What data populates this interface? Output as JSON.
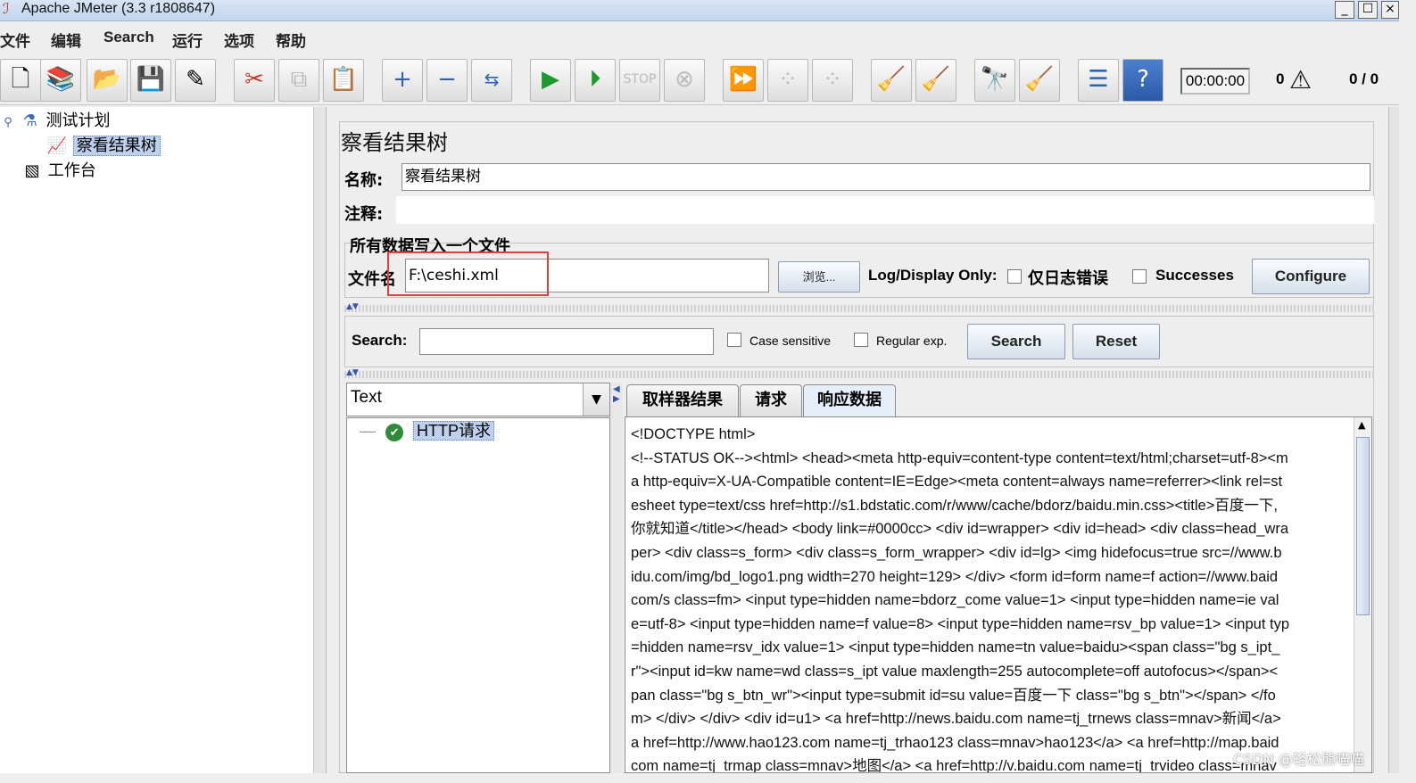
{
  "window": {
    "title": "Apache JMeter (3.3 r1808647)",
    "controls": [
      "_",
      "☐",
      "×"
    ]
  },
  "menu": [
    "文件",
    "编辑",
    "Search",
    "运行",
    "选项",
    "帮助"
  ],
  "toolbar": {
    "icons": [
      "new-icon",
      "templates-icon",
      "open-icon",
      "save-icon",
      "save-as-icon",
      "cut-icon",
      "copy-icon",
      "paste-icon",
      "expand-icon",
      "collapse-icon",
      "toggle-icon",
      "start-icon",
      "start-no-pause-icon",
      "stop-icon",
      "shutdown-icon",
      "remote-start-icon",
      "remote-stop-icon",
      "remote-shutdown-icon",
      "clear-icon",
      "clear-all-icon",
      "search-icon",
      "reset-search-icon",
      "function-helper-icon",
      "help-icon"
    ],
    "timer": "00:00:00",
    "error_count": "0",
    "thread_count": "0 / 0"
  },
  "tree": {
    "plan": "测试计划",
    "listener": "察看结果树",
    "workbench": "工作台"
  },
  "panel": {
    "title": "察看结果树",
    "name_label": "名称:",
    "name_value": "察看结果树",
    "comment_label": "注释:",
    "comment_value": "",
    "group_title": "所有数据写入一个文件",
    "filename_label": "文件名",
    "filename_value": "F:\\ceshi.xml",
    "browse_label": "浏览...",
    "log_only_label": "Log/Display Only:",
    "errors_label": "仅日志错误",
    "successes_label": "Successes",
    "configure_label": "Configure"
  },
  "search": {
    "label": "Search:",
    "value": "",
    "case_label": "Case sensitive",
    "regex_label": "Regular exp.",
    "search_btn": "Search",
    "reset_btn": "Reset"
  },
  "results": {
    "renderer": "Text",
    "sampler": "HTTP请求",
    "tabs": [
      "取样器结果",
      "请求",
      "响应数据"
    ],
    "active_tab": "响应数据",
    "response_lines": [
      "<!DOCTYPE html>",
      "<!--STATUS OK--><html> <head><meta http-equiv=content-type content=text/html;charset=utf-8><m",
      "a http-equiv=X-UA-Compatible content=IE=Edge><meta content=always name=referrer><link rel=st",
      "esheet type=text/css href=http://s1.bdstatic.com/r/www/cache/bdorz/baidu.min.css><title>百度一下,",
      "你就知道</title></head> <body link=#0000cc> <div id=wrapper> <div id=head> <div class=head_wra",
      "per> <div class=s_form> <div class=s_form_wrapper> <div id=lg> <img hidefocus=true src=//www.b",
      "idu.com/img/bd_logo1.png width=270 height=129> </div> <form id=form name=f action=//www.baid",
      "com/s class=fm> <input type=hidden name=bdorz_come value=1> <input type=hidden name=ie val",
      "e=utf-8> <input type=hidden name=f value=8> <input type=hidden name=rsv_bp value=1> <input typ",
      "=hidden name=rsv_idx value=1> <input type=hidden name=tn value=baidu><span class=\"bg s_ipt_",
      "r\"><input id=kw name=wd class=s_ipt value maxlength=255 autocomplete=off autofocus></span><",
      "pan class=\"bg s_btn_wr\"><input type=submit id=su value=百度一下 class=\"bg s_btn\"></span> </fo",
      "m> </div> </div> <div id=u1> <a href=http://news.baidu.com name=tj_trnews class=mnav>新闻</a>",
      "a href=http://www.hao123.com name=tj_trhao123 class=mnav>hao123</a> <a href=http://map.baid",
      "com name=tj_trmap class=mnav>地图</a> <a href=http://v.baidu.com name=tj_trvideo class=mnav"
    ]
  },
  "watermark": "CSDN @轻松熊喵喵",
  "colors": {
    "selection": "#bdd1ee",
    "highlight_box": "#e0413a",
    "ok_green": "#2e8b3a"
  }
}
